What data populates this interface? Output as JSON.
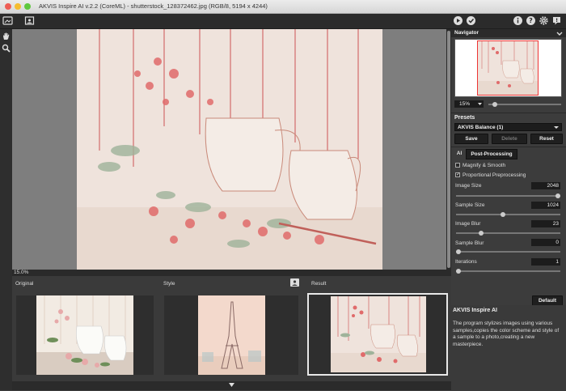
{
  "window": {
    "title": "AKVIS Inspire AI v.2.2 (CoreML) - shutterstock_128372462.jpg (RGB/8, 5194 x 4244)"
  },
  "canvas": {
    "zoom_readout": "15.0%"
  },
  "panels": {
    "original_label": "Original",
    "style_label": "Style",
    "result_label": "Result"
  },
  "navigator": {
    "title": "Navigator",
    "zoom_value": "15%",
    "zoom_level": 0.06
  },
  "presets": {
    "title": "Presets",
    "selected": "AKVIS Balance (1)",
    "save_label": "Save",
    "delete_label": "Delete",
    "reset_label": "Reset"
  },
  "tabs": {
    "ai_label": "AI",
    "post_label": "Post-Processing"
  },
  "settings": {
    "magnify_label": "Magnify & Smooth",
    "magnify_checked": false,
    "proportional_label": "Proportional Preprocessing",
    "proportional_checked": true,
    "image_size": {
      "label": "Image Size",
      "value": "2048",
      "level": 1.0
    },
    "sample_size": {
      "label": "Sample Size",
      "value": "1024",
      "level": 0.45
    },
    "image_blur": {
      "label": "Image Blur",
      "value": "23",
      "level": 0.23
    },
    "sample_blur": {
      "label": "Sample Blur",
      "value": "0",
      "level": 0.0
    },
    "iterations": {
      "label": "Iterations",
      "value": "1",
      "level": 0.0
    },
    "default_label": "Default"
  },
  "help": {
    "title": "AKVIS Inspire AI",
    "text": "The program stylizes images using various samples,copies the color scheme and style of a sample to a photo,creating a new masterpiece."
  },
  "colors": {
    "accent": "#e8e8e8",
    "panel": "#3c3c3c",
    "canvas_bg": "#7e7e7e"
  }
}
